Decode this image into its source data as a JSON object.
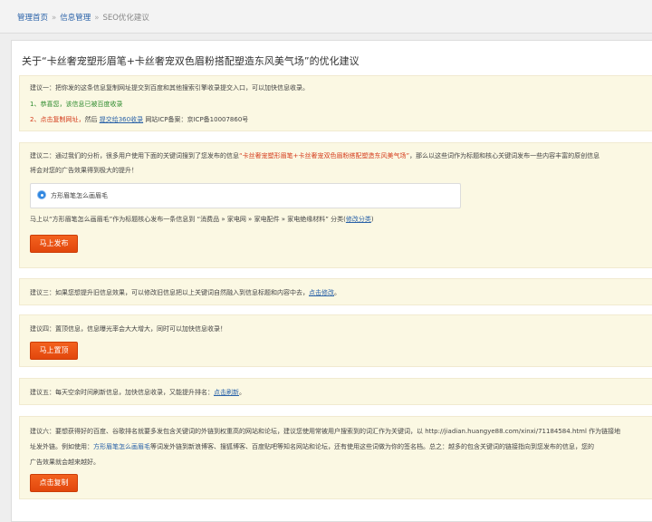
{
  "breadcrumb": {
    "home": "管理首页",
    "info": "信息管理",
    "current": "SEO优化建议"
  },
  "page": {
    "title": "关于“卡丝奢宠塑形眉笔+卡丝奢宠双色眉粉搭配塑造东风美气场”的优化建议"
  },
  "s1": {
    "intro": "建议一：把你发的这条信息复制网址提交到百度和其他搜索引擎收录提交入口，可以加快信息收录。",
    "item1": "1、恭喜您，该信息已被百度收录",
    "item2_prefix": "2、点击复制网址，",
    "item2_then": "然后",
    "item2_link": "提交给360收录",
    "item2_icp": "网站ICP备案：京ICP备10007860号"
  },
  "s2": {
    "line1_prefix": "建议二：通过我们的分析，很多用户使用下面的关键词搜到了您发布的信息",
    "line1_title": "“卡丝奢宠塑形眉笔+卡丝奢宠双色眉粉搭配塑造东风美气场”",
    "line1_suffix": "，那么以这些词作为标题和核心关键词发布一些内容丰富的原创信息",
    "line2": "将会对您的广告效果得到极大的提升！",
    "radio_option": "方形眉笔怎么画眉毛",
    "hint_prefix": "马上以“方形眉笔怎么画眉毛”作为标题核心发布一条信息到 “消费品 » 家电网 » 家电配件 » 家电绝缘材料” 分类(",
    "hint_link": "修改分类",
    "hint_suffix": ")",
    "button": "马上发布"
  },
  "s3": {
    "prefix": "建议三：如果您想提升旧信息效果，可以修改旧信息把以上关键词自然融入到信息标题和内容中去，",
    "link": "点击修改",
    "suffix": "。"
  },
  "s4": {
    "text": "建议四：置顶信息，信息曝光率会大大增大，同时可以加快信息收录！",
    "button": "马上置顶"
  },
  "s5": {
    "prefix": "建议五：每天空余时间刷新信息，加快信息收录，又能提升排名：",
    "link": "点击刷新",
    "suffix": "。"
  },
  "s6": {
    "line1": "建议六：要想获得好的百度、谷歌排名就要多发包含关键词的外链到权重高的网站和论坛，建议您使用常被用户搜索到的词汇作为关键词，以 http://jiadian.huangye88.com/xinxi/71184584.html 作为链接地",
    "line2_prefix": "址发外链。例如使用：",
    "line2_kw": "方形眉笔怎么画眉毛",
    "line2_suffix": "等词发外链到新浪博客、搜狐博客、百度贴吧等知名网站和论坛，还有使用这些词做为你的签名档。总之：越多的包含关键词的链接指向到您发布的信息，您的",
    "line3": "广告效果就会越来越好。",
    "button": "点击复制"
  }
}
